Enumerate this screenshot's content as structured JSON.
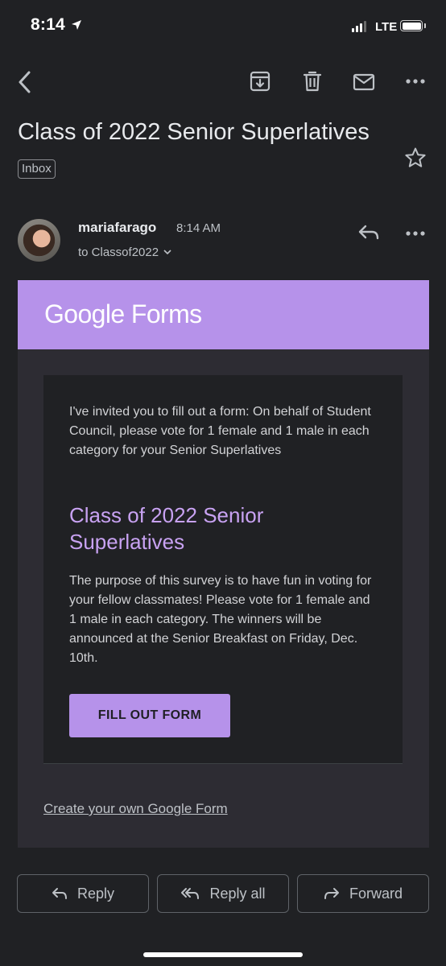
{
  "status_bar": {
    "time": "8:14",
    "network": "LTE",
    "location_icon": "location-arrow-icon",
    "battery_icon": "battery-icon"
  },
  "toolbar": {
    "back_icon": "back-icon",
    "archive_icon": "archive-icon",
    "delete_icon": "trash-icon",
    "mark_unread_icon": "mail-icon",
    "more_icon": "more-horizontal-icon"
  },
  "email": {
    "subject": "Class of 2022 Senior Superlatives",
    "label": "Inbox",
    "sender": "mariafarago",
    "time": "8:14 AM",
    "recipient": "to Classof2022"
  },
  "form_card": {
    "logo_google": "Google",
    "logo_forms": "Forms",
    "intro": "I've invited you to fill out a form: On behalf of Student Council, please vote for 1 female and 1 male in each category for your Senior Superlatives",
    "title": "Class of 2022 Senior Superlatives",
    "description": "The purpose of this survey is to have fun in voting for your fellow classmates! Please vote for 1 female and 1 male in each category. The winners will be announced at the Senior Breakfast on Friday, Dec. 10th.",
    "button_label": "FILL OUT FORM",
    "create_link": "Create your own Google Form"
  },
  "actions": {
    "reply": "Reply",
    "reply_all": "Reply all",
    "forward": "Forward"
  },
  "colors": {
    "background": "#202124",
    "accent": "#b692ea",
    "title_purple": "#c8a2f2"
  }
}
